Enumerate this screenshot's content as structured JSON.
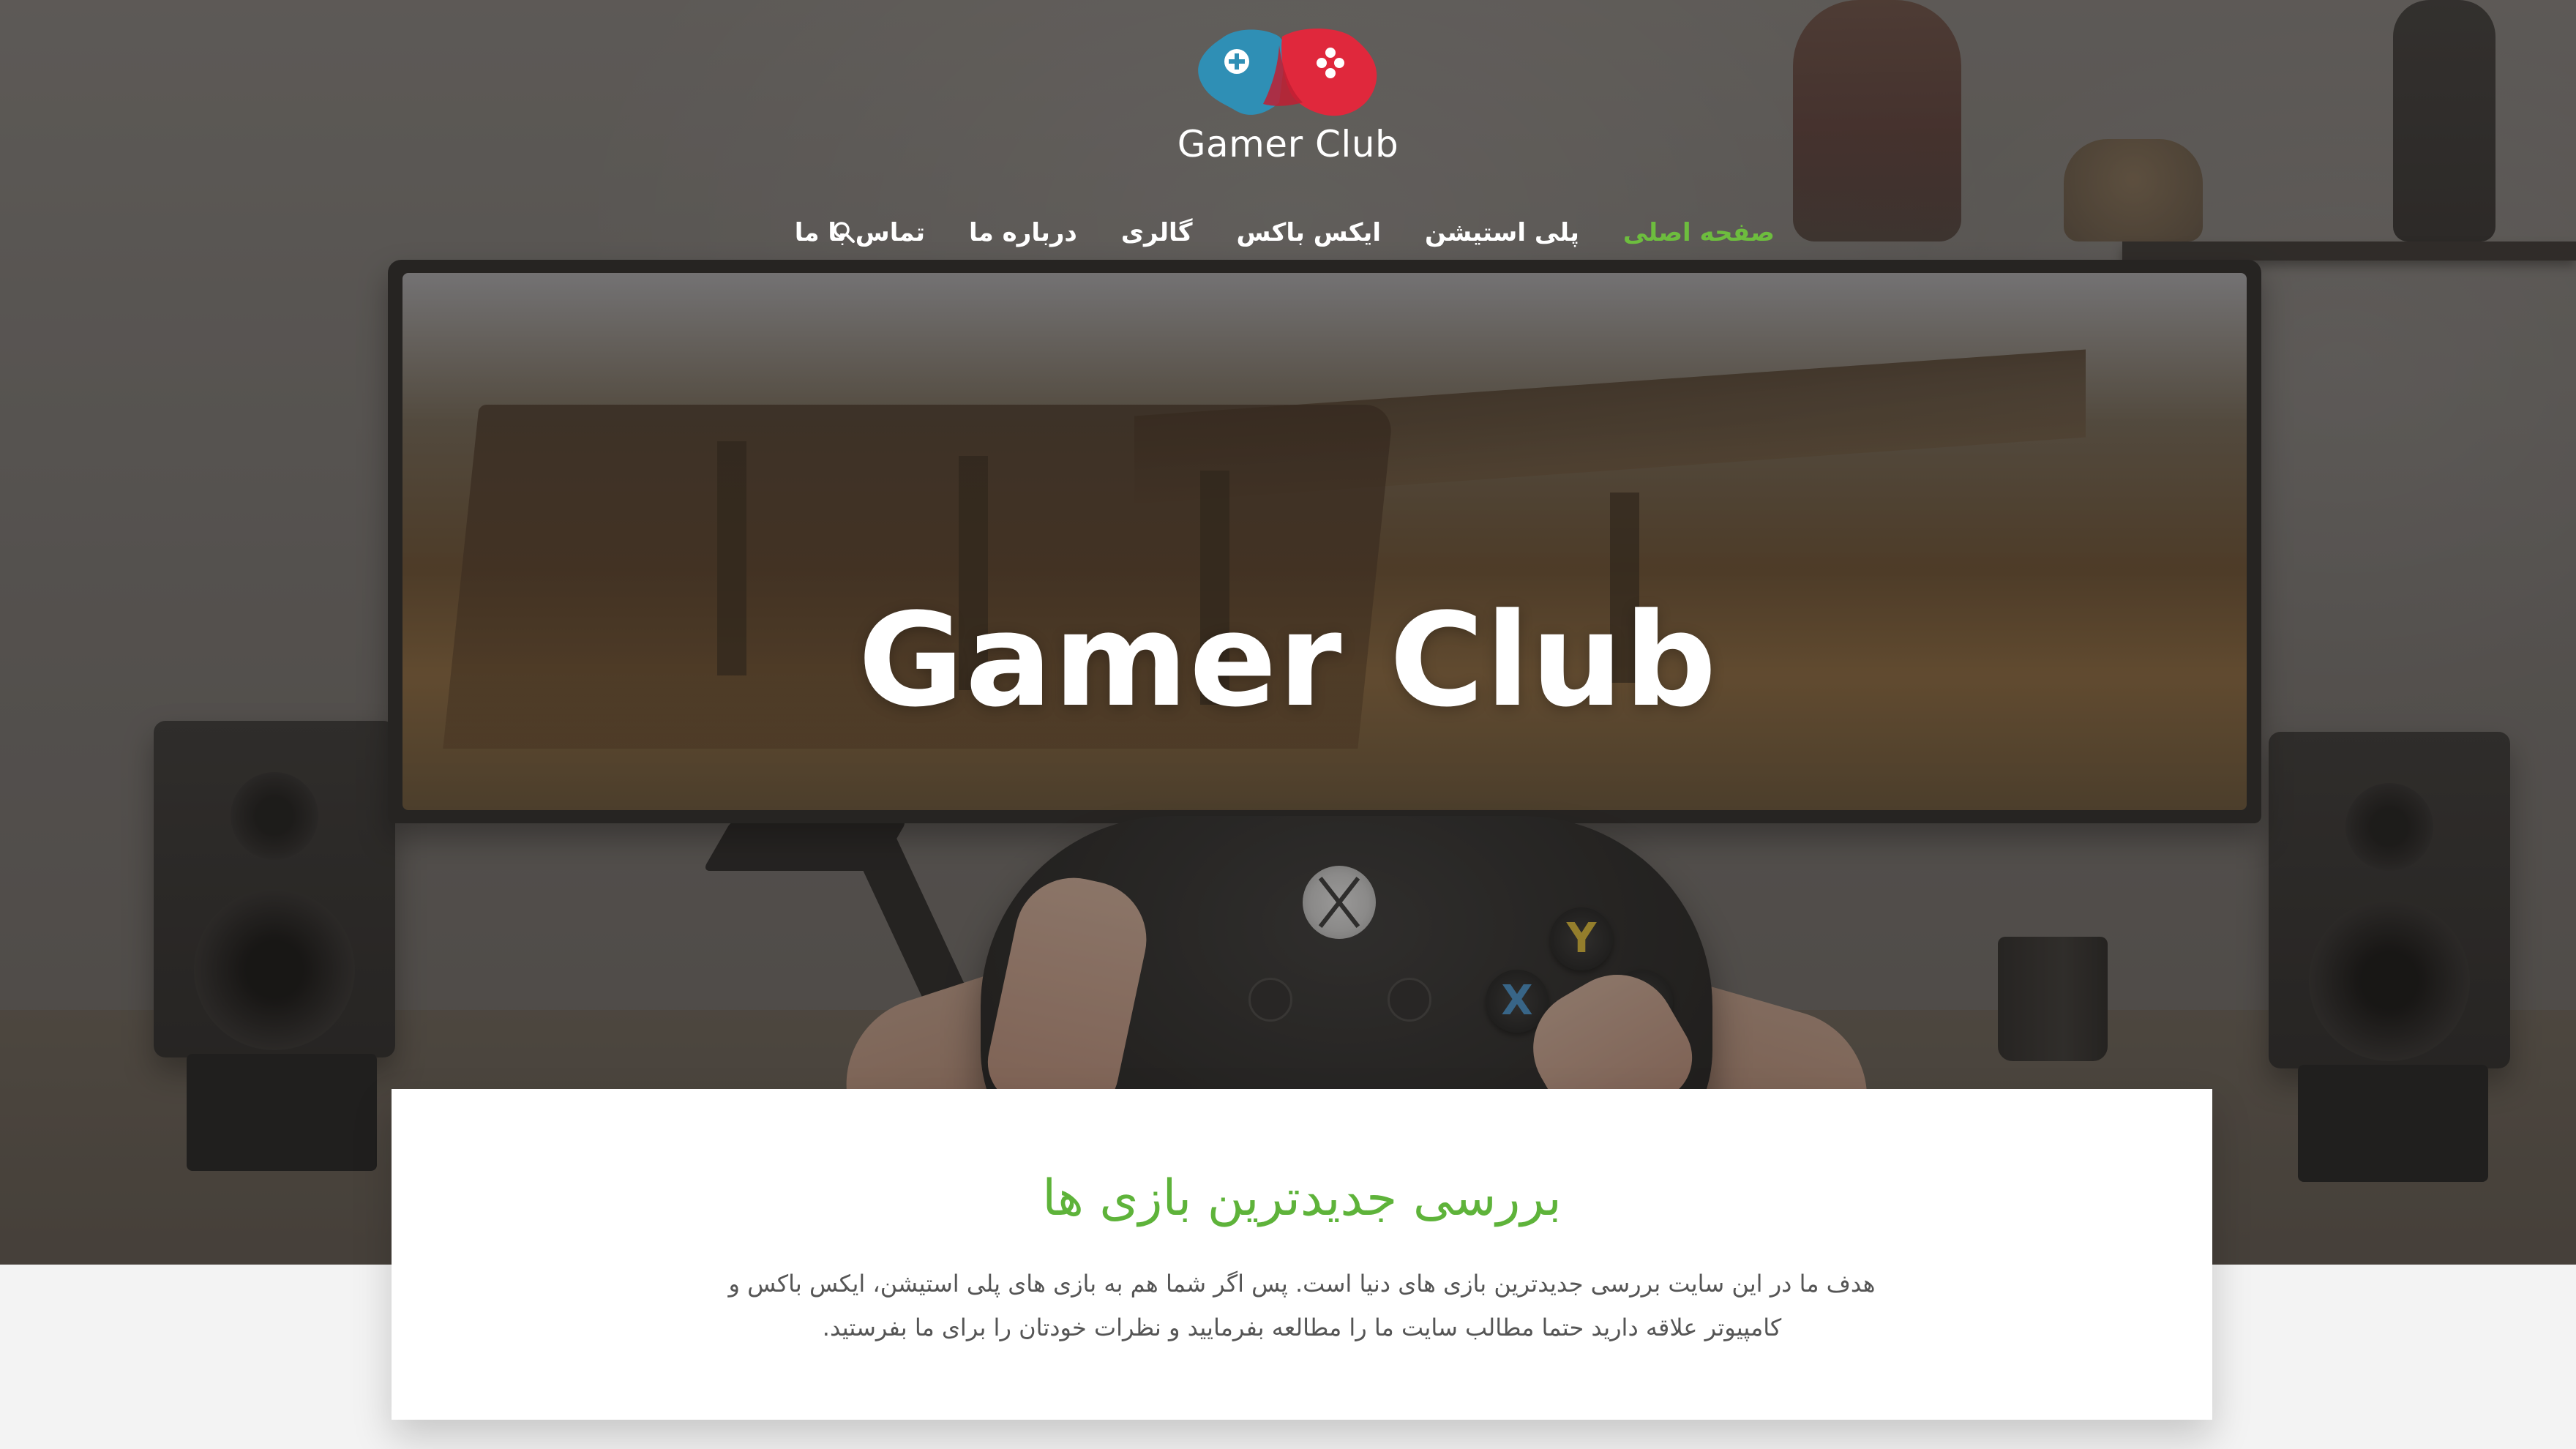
{
  "header": {
    "logo_text": "Gamer Club",
    "nav": [
      {
        "label": "صفحه اصلی",
        "active": true
      },
      {
        "label": "پلی استیشن",
        "active": false
      },
      {
        "label": "ایکس باکس",
        "active": false
      },
      {
        "label": "گالری",
        "active": false
      },
      {
        "label": "درباره ما",
        "active": false
      },
      {
        "label": "تماس با ما",
        "active": false
      }
    ],
    "search_icon": "search-icon"
  },
  "hero": {
    "title": "Gamer Club"
  },
  "intro": {
    "heading": "بررسی جدیدترین بازی ها",
    "text": "هدف ما در این سایت بررسی جدیدترین بازی های دنیا است. پس اگر شما هم به بازی های  پلی استیشن، ایکس باکس و کامپیوتر علاقه دارید حتما مطالب سایت ما را مطالعه بفرمایید و نظرات خودتان را برای ما بفرستید."
  },
  "colors": {
    "accent": "#5eb33a",
    "active_nav": "#6dbd3e",
    "logo_blue": "#2f8fb5",
    "logo_red": "#e0283c"
  }
}
